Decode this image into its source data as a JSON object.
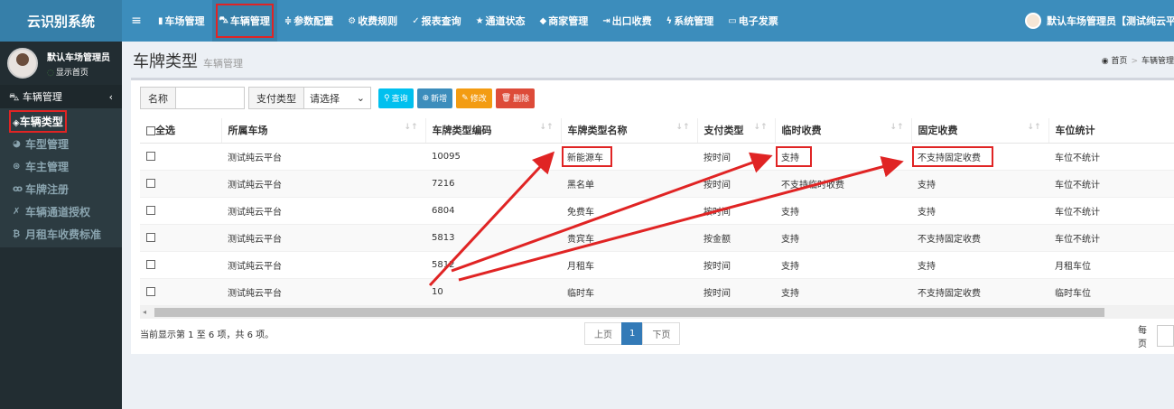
{
  "app": {
    "title": "云识别系统"
  },
  "topnav": {
    "items": [
      {
        "label": "车场管理"
      },
      {
        "label": "车辆管理"
      },
      {
        "label": "参数配置"
      },
      {
        "label": "收费规则"
      },
      {
        "label": "报表查询"
      },
      {
        "label": "通道状态"
      },
      {
        "label": "商家管理"
      },
      {
        "label": "出口收费"
      },
      {
        "label": "系统管理"
      },
      {
        "label": "电子发票"
      }
    ],
    "user": "默认车场管理员【测试纯云平"
  },
  "sidebar": {
    "user_name": "默认车场管理员",
    "user_status": "显示首页",
    "section": "车辆管理",
    "items": [
      {
        "label": "车辆类型"
      },
      {
        "label": "车型管理"
      },
      {
        "label": "车主管理"
      },
      {
        "label": "车牌注册"
      },
      {
        "label": "车辆通道授权"
      },
      {
        "label": "月租车收费标准"
      }
    ]
  },
  "page": {
    "title": "车牌类型",
    "subtitle": "车辆管理",
    "breadcrumb_home": "首页",
    "breadcrumb_current": "车辆管理"
  },
  "toolbar": {
    "name_label": "名称",
    "name_value": "",
    "pay_label": "支付类型",
    "pay_select": "请选择",
    "query": "查询",
    "add": "新增",
    "edit": "修改",
    "delete": "删除"
  },
  "table": {
    "headers": [
      "全选",
      "所属车场",
      "车牌类型编码",
      "车牌类型名称",
      "支付类型",
      "临时收费",
      "固定收费",
      "车位统计"
    ],
    "rows": [
      [
        "测试纯云平台",
        "10095",
        "新能源车",
        "按时间",
        "支持",
        "不支持固定收费",
        "车位不统计"
      ],
      [
        "测试纯云平台",
        "7216",
        "黑名单",
        "按时间",
        "不支持临时收费",
        "支持",
        "车位不统计"
      ],
      [
        "测试纯云平台",
        "6804",
        "免费车",
        "按时间",
        "支持",
        "支持",
        "车位不统计"
      ],
      [
        "测试纯云平台",
        "5813",
        "贵宾车",
        "按金额",
        "支持",
        "不支持固定收费",
        "车位不统计"
      ],
      [
        "测试纯云平台",
        "5812",
        "月租车",
        "按时间",
        "支持",
        "支持",
        "月租车位"
      ],
      [
        "测试纯云平台",
        "10",
        "临时车",
        "按时间",
        "支持",
        "不支持固定收费",
        "临时车位"
      ]
    ]
  },
  "footer": {
    "info": "当前显示第 1 至 6 项，共 6 项。",
    "prev": "上页",
    "page": "1",
    "next": "下页",
    "per_page": "每页"
  },
  "colors": {
    "primary": "#3c8dbc",
    "sidebar": "#222d32",
    "annotation": "#e02424"
  }
}
